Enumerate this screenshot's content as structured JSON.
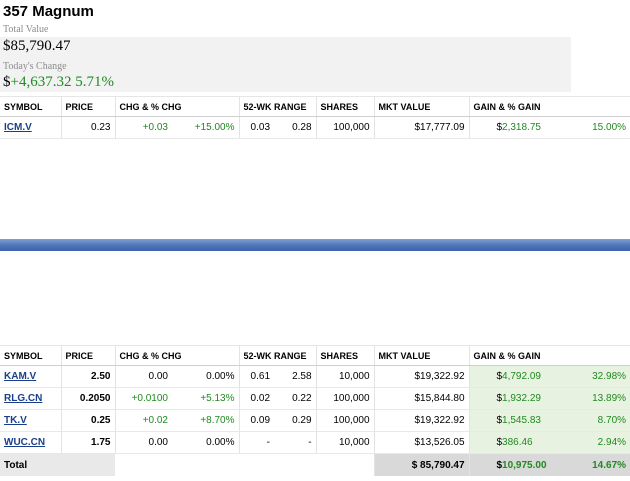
{
  "portfolio": {
    "title": "357 Magnum",
    "total_value_label": "Total Value",
    "total_value": "$85,790.47",
    "todays_change_label": "Today's Change",
    "todays_change_dollar": "$",
    "todays_change_amount": "+4,637.32",
    "todays_change_pct": "5.71%"
  },
  "columns": [
    "SYMBOL",
    "PRICE",
    "CHG & % CHG",
    "52-WK RANGE",
    "SHARES",
    "MKT VALUE",
    "GAIN & % GAIN"
  ],
  "top_table": {
    "rows": [
      {
        "symbol": "ICM.V",
        "price": "0.23",
        "chg": "+0.03",
        "chg_pct": "+15.00%",
        "low": "0.03",
        "high": "0.28",
        "shares": "100,000",
        "mkt_value": "$17,777.09",
        "gain_dollar": "$",
        "gain": "2,318.75",
        "gain_pct": "15.00%"
      }
    ]
  },
  "bottom_table": {
    "rows": [
      {
        "symbol": "KAM.V",
        "price": "2.50",
        "chg": "0.00",
        "chg_pct": "0.00%",
        "low": "0.61",
        "high": "2.58",
        "shares": "10,000",
        "mkt_value": "$19,322.92",
        "gain_dollar": "$",
        "gain": "4,792.09",
        "gain_pct": "32.98%"
      },
      {
        "symbol": "RLG.CN",
        "price": "0.2050",
        "chg": "+0.0100",
        "chg_pct": "+5.13%",
        "low": "0.02",
        "high": "0.22",
        "shares": "100,000",
        "mkt_value": "$15,844.80",
        "gain_dollar": "$",
        "gain": "1,932.29",
        "gain_pct": "13.89%"
      },
      {
        "symbol": "TK.V",
        "price": "0.25",
        "chg": "+0.02",
        "chg_pct": "+8.70%",
        "low": "0.09",
        "high": "0.29",
        "shares": "100,000",
        "mkt_value": "$19,322.92",
        "gain_dollar": "$",
        "gain": "1,545.83",
        "gain_pct": "8.70%"
      },
      {
        "symbol": "WUC.CN",
        "price": "1.75",
        "chg": "0.00",
        "chg_pct": "0.00%",
        "low": "-",
        "high": "-",
        "shares": "10,000",
        "mkt_value": "$13,526.05",
        "gain_dollar": "$",
        "gain": "386.46",
        "gain_pct": "2.94%"
      }
    ],
    "total": {
      "label": "Total",
      "mkt_value": "$ 85,790.47",
      "gain_dollar": "$",
      "gain": "10,975.00",
      "gain_pct": "14.67%"
    }
  },
  "colors": {
    "positive": "#1f8a1f",
    "link": "#1a3f8a",
    "divider": "#4f74b8"
  }
}
